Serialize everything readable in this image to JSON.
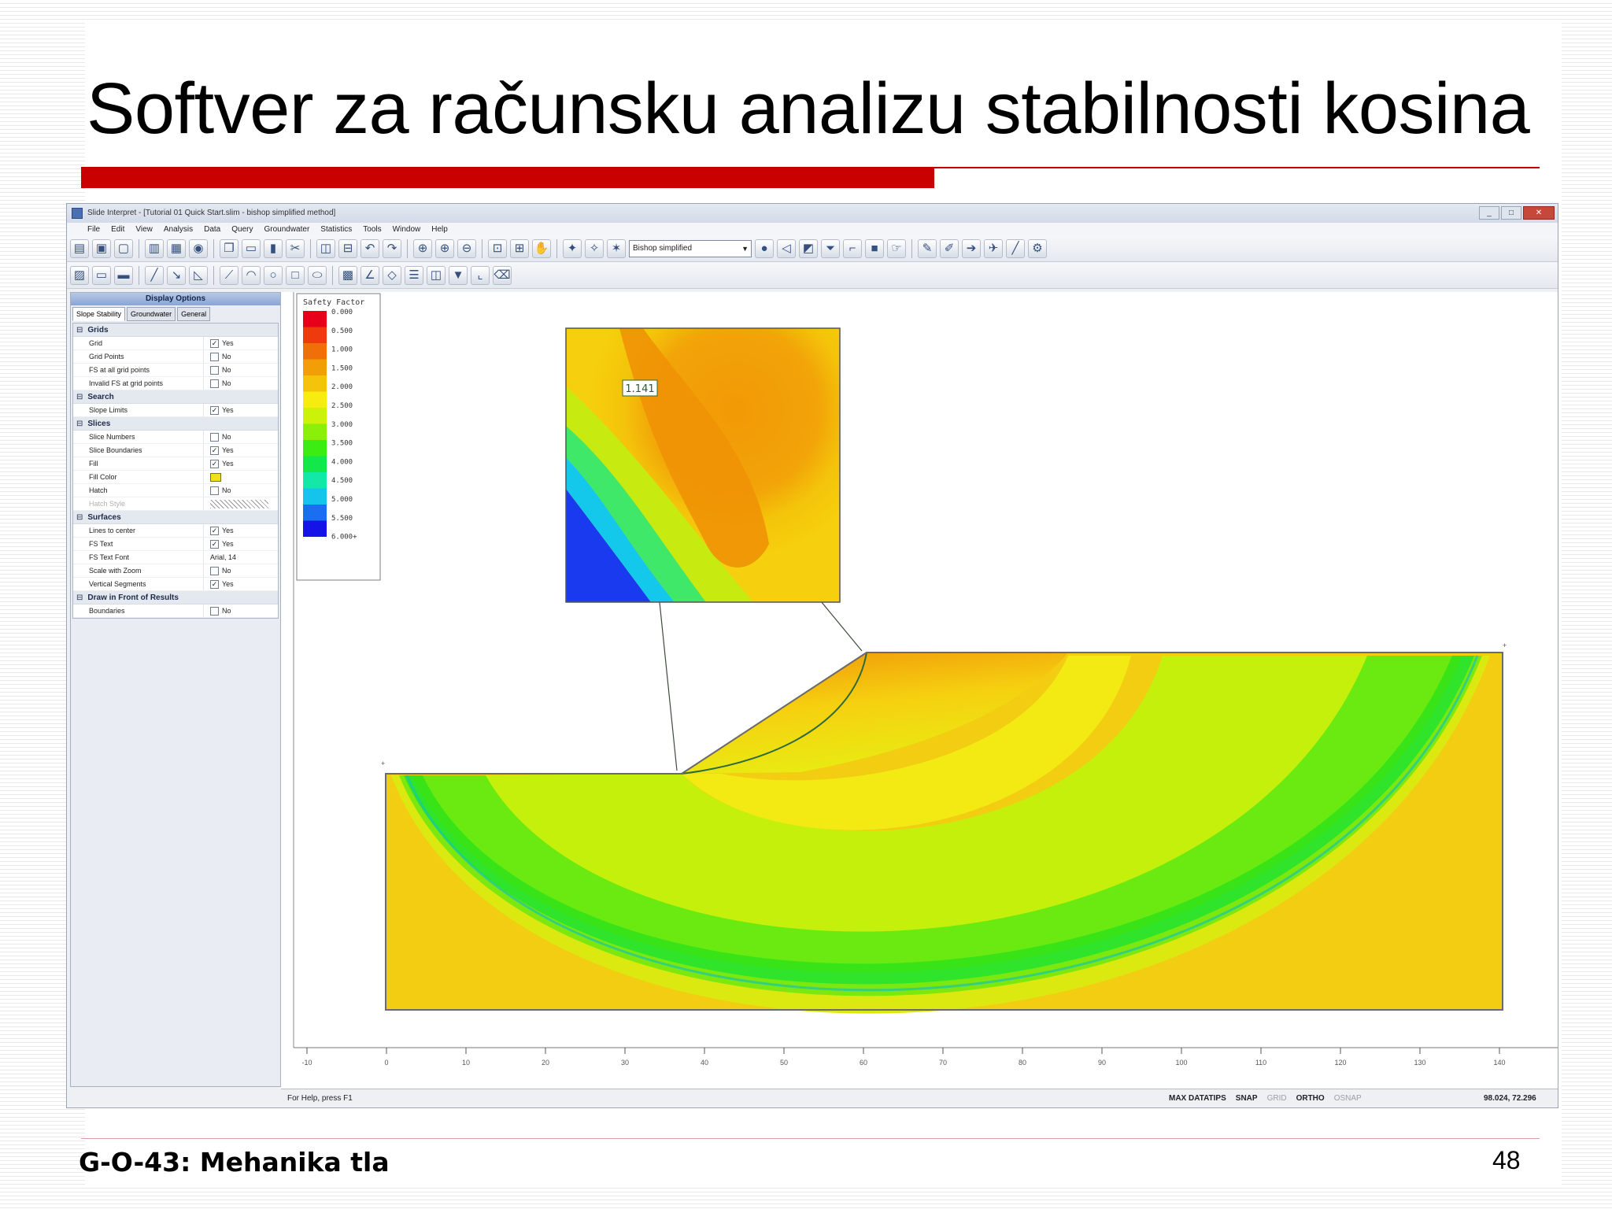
{
  "slide": {
    "title": "Softver za računsku analizu stabilnosti kosina",
    "footer": "G-O-43: Mehanika tla",
    "page_number": "48",
    "accent_color": "#c80000"
  },
  "window": {
    "title": "Slide Interpret - [Tutorial 01 Quick Start.slim - bishop simplified method]",
    "controls": {
      "minimize": "_",
      "maximize": "□",
      "close": "✕"
    }
  },
  "menu": [
    "File",
    "Edit",
    "View",
    "Analysis",
    "Data",
    "Query",
    "Groundwater",
    "Statistics",
    "Tools",
    "Window",
    "Help"
  ],
  "toolbar": {
    "method_select": "Bishop simplified"
  },
  "display_options": {
    "header": "Display Options",
    "tabs": [
      "Slope Stability",
      "Groundwater",
      "General"
    ],
    "active_tab": 0,
    "categories": [
      {
        "name": "Grids",
        "rows": [
          {
            "label": "Grid",
            "value": "Yes",
            "checked": true
          },
          {
            "label": "Grid Points",
            "value": "No",
            "checked": false
          },
          {
            "label": "FS at all grid points",
            "value": "No",
            "checked": false
          },
          {
            "label": "Invalid FS at grid points",
            "value": "No",
            "checked": false
          }
        ]
      },
      {
        "name": "Search",
        "rows": [
          {
            "label": "Slope Limits",
            "value": "Yes",
            "checked": true
          }
        ]
      },
      {
        "name": "Slices",
        "rows": [
          {
            "label": "Slice Numbers",
            "value": "No",
            "checked": false
          },
          {
            "label": "Slice Boundaries",
            "value": "Yes",
            "checked": true
          },
          {
            "label": "Fill",
            "value": "Yes",
            "checked": true
          },
          {
            "label": "Fill Color",
            "value": "",
            "swatch": true
          },
          {
            "label": "Hatch",
            "value": "No",
            "checked": false
          },
          {
            "label": "Hatch Style",
            "value": "",
            "hatch": true,
            "disabled": true
          }
        ]
      },
      {
        "name": "Surfaces",
        "rows": [
          {
            "label": "Lines to center",
            "value": "Yes",
            "checked": true
          },
          {
            "label": "FS Text",
            "value": "Yes",
            "checked": true
          },
          {
            "label": "FS Text Font",
            "value": "Arial, 14"
          },
          {
            "label": "Scale with Zoom",
            "value": "No",
            "checked": false
          },
          {
            "label": "Vertical Segments",
            "value": "Yes",
            "checked": true
          }
        ]
      },
      {
        "name": "Draw in Front of Results",
        "rows": [
          {
            "label": "Boundaries",
            "value": "No",
            "checked": false
          }
        ]
      }
    ]
  },
  "legend": {
    "title": "Safety Factor",
    "labels": [
      "0.000",
      "0.500",
      "1.000",
      "1.500",
      "2.000",
      "2.500",
      "3.000",
      "3.500",
      "4.000",
      "4.500",
      "5.000",
      "5.500",
      "6.000+"
    ],
    "colors": [
      "#e8001a",
      "#ee3a0c",
      "#f06f08",
      "#f29e06",
      "#f4c40a",
      "#f6ec10",
      "#cbf208",
      "#8cef0a",
      "#3cec12",
      "#12e84a",
      "#12e8a8",
      "#14c4ec",
      "#1a6ef0",
      "#1414e8"
    ]
  },
  "model": {
    "critical_fs": "1.141",
    "zoom_inset": true
  },
  "axis": {
    "x_ticks": [
      "-10",
      "0",
      "10",
      "20",
      "30",
      "40",
      "50",
      "60",
      "70",
      "80",
      "90",
      "100",
      "110",
      "120",
      "130",
      "140"
    ]
  },
  "status": {
    "help": "For Help, press F1",
    "items": [
      {
        "text": "MAX DATATIPS",
        "dim": false
      },
      {
        "text": "SNAP",
        "dim": false
      },
      {
        "text": "GRID",
        "dim": true
      },
      {
        "text": "ORTHO",
        "dim": false
      },
      {
        "text": "OSNAP",
        "dim": true
      }
    ],
    "coords": "98.024, 72.296"
  }
}
